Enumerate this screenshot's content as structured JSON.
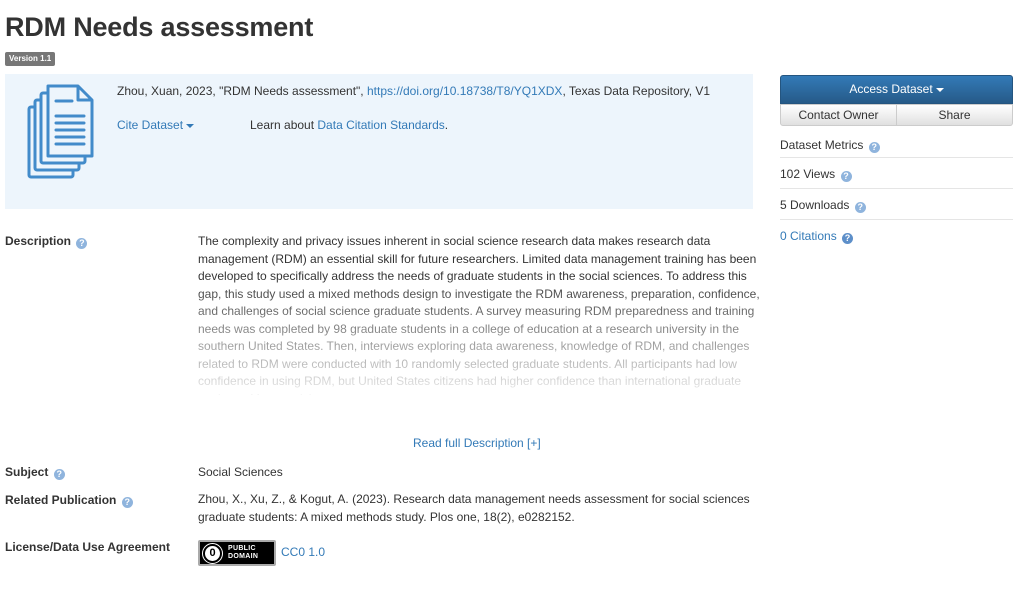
{
  "header": {
    "title": "RDM Needs assessment",
    "version": "Version 1.1"
  },
  "citation": {
    "prefix": "Zhou, Xuan, 2023, \"RDM Needs assessment\", ",
    "doi": "https://doi.org/10.18738/T8/YQ1XDX",
    "suffix": ", Texas Data Repository, V1",
    "cite_label": "Cite Dataset",
    "learn_prefix": "Learn about ",
    "learn_link": "Data Citation Standards",
    "learn_suffix": ".",
    "icon": "dataset-files-icon",
    "icon_color": "#428bca",
    "panel_bg": "#edf5fc"
  },
  "sidebar": {
    "access_label": "Access Dataset",
    "contact_label": "Contact Owner",
    "share_label": "Share",
    "metrics_label": "Dataset Metrics",
    "views": "102 Views",
    "downloads": "5 Downloads",
    "citations": "0 Citations",
    "accent": "#337ab7"
  },
  "fields": {
    "description_label": "Description",
    "description": "The complexity and privacy issues inherent in social science research data makes research data management (RDM) an essential skill for future researchers. Limited data management training has been developed to specifically address the needs of graduate students in the social sciences. To address this gap, this study used a mixed methods design to investigate the RDM awareness, preparation, confidence, and challenges of social science graduate students. A survey measuring RDM preparedness and training needs was completed by 98 graduate students in a college of education at a research university in the southern United States. Then, interviews exploring data awareness, knowledge of RDM, and challenges related to RDM were conducted with 10 randomly selected graduate students. All participants had low confidence in using RDM, but United States citizens had higher confidence than international graduate students. Most participants were not aware",
    "read_more": "Read full Description [+]",
    "subject_label": "Subject",
    "subject": "Social Sciences",
    "publication_label": "Related Publication",
    "publication": "Zhou, X., Xu, Z., & Kogut, A. (2023). Research data management needs assessment for social sciences graduate students: A mixed methods study. Plos one, 18(2), e0282152.",
    "license_label": "License/Data Use Agreement",
    "license_badge_top": "PUBLIC",
    "license_badge_bottom": "DOMAIN",
    "license_link": "CC0 1.0"
  }
}
